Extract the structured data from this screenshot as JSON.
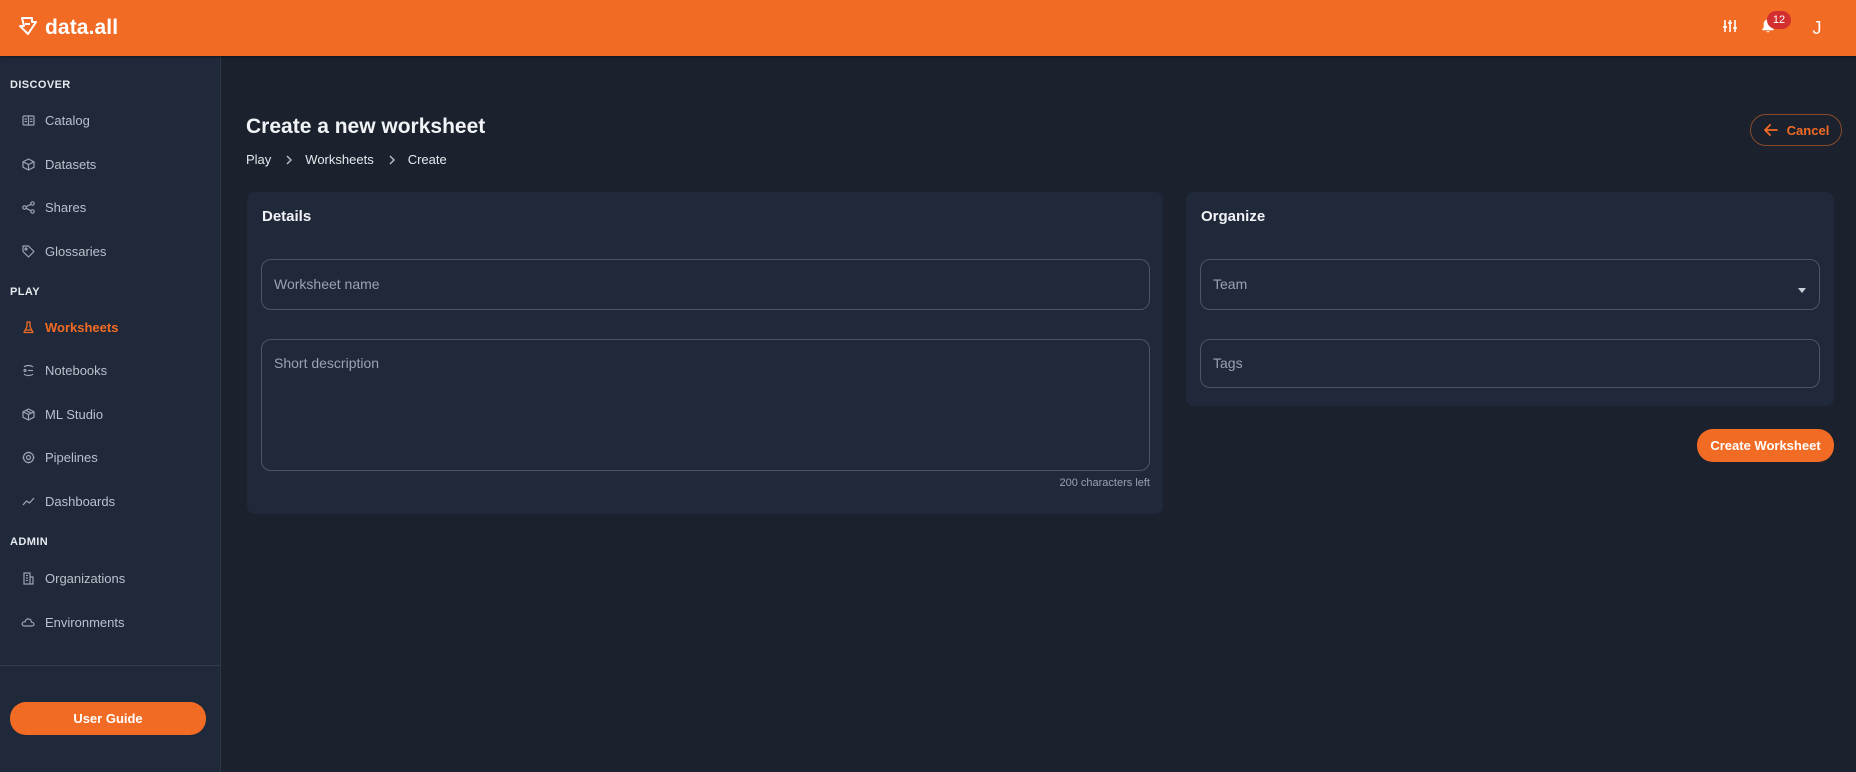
{
  "app": {
    "name": "data.all"
  },
  "topbar": {
    "notification_count": "12",
    "user_initial": "J",
    "icons": [
      "settings-sliders-icon",
      "bell-icon"
    ]
  },
  "sidebar": {
    "sections": [
      {
        "title": "DISCOVER",
        "items": [
          {
            "label": "Catalog",
            "icon": "catalog-icon"
          },
          {
            "label": "Datasets",
            "icon": "cube-icon"
          },
          {
            "label": "Shares",
            "icon": "share-icon"
          },
          {
            "label": "Glossaries",
            "icon": "tag-icon"
          }
        ]
      },
      {
        "title": "PLAY",
        "items": [
          {
            "label": "Worksheets",
            "icon": "flask-icon",
            "active": true
          },
          {
            "label": "Notebooks",
            "icon": "notebook-icon"
          },
          {
            "label": "ML Studio",
            "icon": "cube-icon"
          },
          {
            "label": "Pipelines",
            "icon": "gear-icon"
          },
          {
            "label": "Dashboards",
            "icon": "chart-line-icon"
          }
        ]
      },
      {
        "title": "ADMIN",
        "items": [
          {
            "label": "Organizations",
            "icon": "building-icon"
          },
          {
            "label": "Environments",
            "icon": "cloud-icon"
          }
        ]
      }
    ],
    "guide_label": "User Guide"
  },
  "page": {
    "title": "Create a new worksheet",
    "breadcrumb": [
      "Play",
      "Worksheets",
      "Create"
    ],
    "cancel_label": "Cancel"
  },
  "details": {
    "title": "Details",
    "name_placeholder": "Worksheet name",
    "description_placeholder": "Short description",
    "chars_left": "200 characters left"
  },
  "organize": {
    "title": "Organize",
    "team_placeholder": "Team",
    "tags_placeholder": "Tags"
  },
  "actions": {
    "create_label": "Create Worksheet"
  },
  "colors": {
    "accent": "#f26b25",
    "background": "#1b222d",
    "card": "#1f2939",
    "badge": "#d32f2f"
  }
}
